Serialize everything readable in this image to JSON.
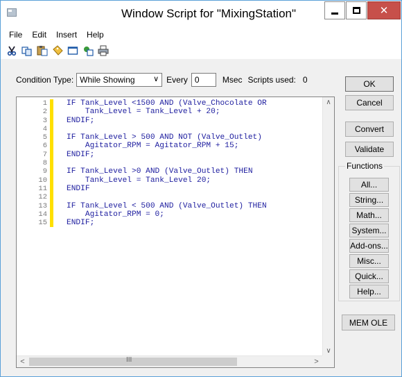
{
  "window": {
    "title": "Window Script for \"MixingStation\""
  },
  "menu": {
    "items": [
      "File",
      "Edit",
      "Insert",
      "Help"
    ]
  },
  "toolbar": {
    "icons": [
      "cut-icon",
      "copy-icon",
      "paste-icon",
      "tag-icon",
      "window-icon",
      "convert-icon",
      "print-icon"
    ]
  },
  "condition": {
    "type_label": "Condition Type:",
    "type_value": "While Showing",
    "every_label": "Every",
    "every_value": "0",
    "msec_label": "Msec",
    "scripts_used_label": "Scripts used:",
    "scripts_used_value": "0"
  },
  "editor": {
    "lines": [
      {
        "n": "1",
        "text": "IF Tank_Level <1500 AND (Valve_Chocolate OR"
      },
      {
        "n": "2",
        "text": "    Tank_Level = Tank_Level + 20;"
      },
      {
        "n": "3",
        "text": "ENDIF;"
      },
      {
        "n": "4",
        "text": ""
      },
      {
        "n": "5",
        "text": "IF Tank_Level > 500 AND NOT (Valve_Outlet)"
      },
      {
        "n": "6",
        "text": "    Agitator_RPM = Agitator_RPM + 15;"
      },
      {
        "n": "7",
        "text": "ENDIF;"
      },
      {
        "n": "8",
        "text": ""
      },
      {
        "n": "9",
        "text": "IF Tank_Level >0 AND (Valve_Outlet) THEN"
      },
      {
        "n": "10",
        "text": "    Tank_Level = Tank_Level 20;"
      },
      {
        "n": "11",
        "text": "ENDIF"
      },
      {
        "n": "12",
        "text": ""
      },
      {
        "n": "13",
        "text": "IF Tank_Level < 500 AND (Valve_Outlet) THEN"
      },
      {
        "n": "14",
        "text": "    Agitator_RPM = 0;"
      },
      {
        "n": "15",
        "text": "ENDIF;"
      }
    ],
    "hscroll_grip": "III"
  },
  "buttons": {
    "ok": "OK",
    "cancel": "Cancel",
    "convert": "Convert",
    "validate": "Validate",
    "mem_ole": "MEM OLE"
  },
  "functions": {
    "label": "Functions",
    "items": [
      "All...",
      "String...",
      "Math...",
      "System...",
      "Add-ons...",
      "Misc...",
      "Quick...",
      "Help..."
    ]
  }
}
